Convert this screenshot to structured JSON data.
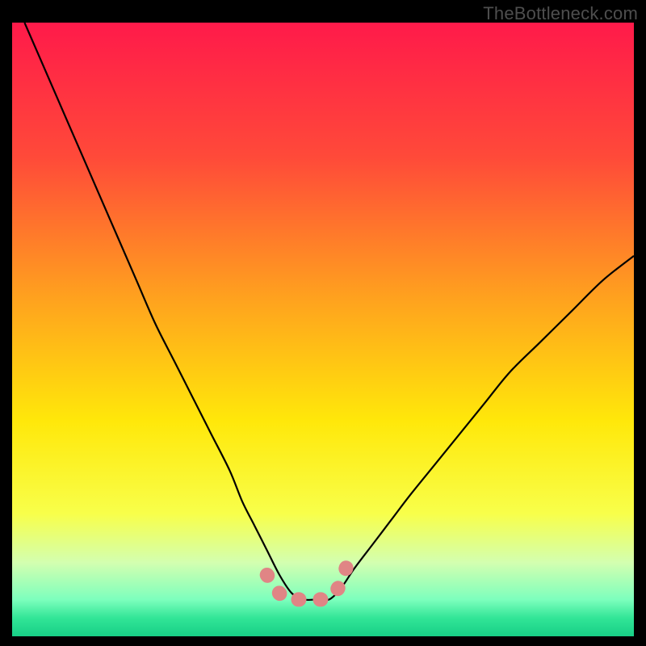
{
  "watermark": "TheBottleneck.com",
  "chart_data": {
    "type": "line",
    "title": "",
    "xlabel": "",
    "ylabel": "",
    "xlim": [
      0,
      100
    ],
    "ylim": [
      0,
      100
    ],
    "series": [
      {
        "name": "bottleneck-curve",
        "x": [
          2,
          5,
          8,
          11,
          14,
          17,
          20,
          23,
          26,
          29,
          32,
          35,
          37,
          39,
          41,
          43,
          45,
          47,
          49,
          51,
          53,
          55,
          58,
          61,
          64,
          68,
          72,
          76,
          80,
          85,
          90,
          95,
          100
        ],
        "y": [
          100,
          93,
          86,
          79,
          72,
          65,
          58,
          51,
          45,
          39,
          33,
          27,
          22,
          18,
          14,
          10,
          7,
          6,
          6,
          6,
          8,
          11,
          15,
          19,
          23,
          28,
          33,
          38,
          43,
          48,
          53,
          58,
          62
        ]
      }
    ],
    "highlight": {
      "name": "highlight-segment",
      "x": [
        41,
        43,
        44,
        46,
        48,
        50,
        52,
        53,
        54
      ],
      "y": [
        10,
        7,
        6,
        6,
        6,
        6,
        7,
        9,
        12
      ]
    },
    "gradient": {
      "stops": [
        {
          "offset": 0.0,
          "color": "#ff1a4a"
        },
        {
          "offset": 0.22,
          "color": "#ff4a39"
        },
        {
          "offset": 0.45,
          "color": "#ffa21e"
        },
        {
          "offset": 0.65,
          "color": "#ffe80a"
        },
        {
          "offset": 0.8,
          "color": "#f8ff4a"
        },
        {
          "offset": 0.88,
          "color": "#d3ffb0"
        },
        {
          "offset": 0.94,
          "color": "#7dffbd"
        },
        {
          "offset": 0.97,
          "color": "#32e597"
        },
        {
          "offset": 1.0,
          "color": "#17cf86"
        }
      ]
    }
  }
}
